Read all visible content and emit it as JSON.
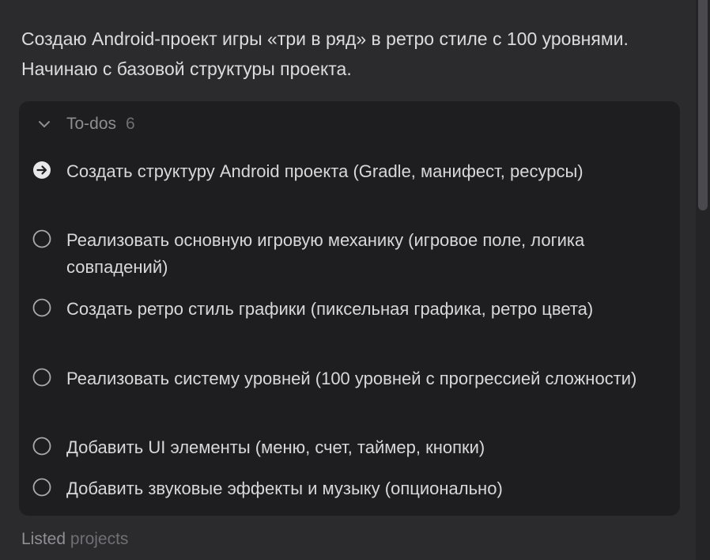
{
  "message": {
    "text": "Создаю Android-проект игры «три в ряд» в ретро стиле с 100 уровнями. Начинаю с базовой структуры проекта."
  },
  "todos": {
    "title": "To-dos",
    "count": "6",
    "items": [
      {
        "label": "Создать структуру Android проекта (Gradle, манифест, ресурсы)",
        "status": "in-progress"
      },
      {
        "label": "Реализовать основную игровую механику (игровое поле, логика совпадений)",
        "status": "pending"
      },
      {
        "label": "Создать ретро стиль графики (пиксельная графика, ретро цвета)",
        "status": "pending"
      },
      {
        "label": "Реализовать систему уровней (100 уровней с прогрессией сложности)",
        "status": "pending"
      },
      {
        "label": "Добавить UI элементы (меню, счет, таймер, кнопки)",
        "status": "pending"
      },
      {
        "label": "Добавить звуковые эффекты и музыку (опционально)",
        "status": "pending"
      }
    ]
  },
  "footer": {
    "label_first": "Listed",
    "label_second": "projects"
  },
  "colors": {
    "background": "#2b2b2e",
    "card": "#1e1e20",
    "text": "#d8d8da",
    "muted": "#8d8d92"
  },
  "icons": {
    "in_progress": "arrow-right-circle-icon",
    "pending": "empty-circle-icon",
    "collapse": "chevron-down-icon"
  }
}
